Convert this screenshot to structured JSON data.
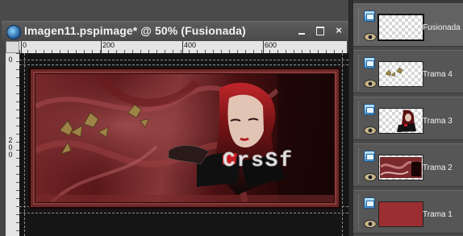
{
  "window": {
    "title": "Imagen11.pspimage* @  50% (Fusionada)",
    "buttons": {
      "minimize": "",
      "maximize": "",
      "close": "×"
    }
  },
  "ruler": {
    "h_labels": [
      "0",
      "200",
      "400",
      "600"
    ],
    "v_labels": [
      "0",
      "2\n0\n0"
    ]
  },
  "canvas": {
    "watermark_text": "CrsSf"
  },
  "layers": [
    {
      "name": "Fusionada",
      "selected": true,
      "thumb": "transparent"
    },
    {
      "name": "Trama 4",
      "selected": false,
      "thumb": "butterflies"
    },
    {
      "name": "Trama 3",
      "selected": false,
      "thumb": "woman"
    },
    {
      "name": "Trama 2",
      "selected": false,
      "thumb": "frame"
    },
    {
      "name": "Trama 1",
      "selected": false,
      "thumb": "red-fill"
    }
  ],
  "colors": {
    "accent_red": "#8b3a3c",
    "frame_dark": "#2a0c0c",
    "panel_bg": "#4a4a4a"
  }
}
